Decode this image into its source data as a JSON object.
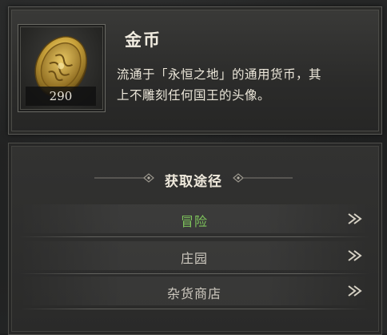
{
  "item": {
    "name": "金币",
    "quantity": "290",
    "description_line1": "流通于「永恒之地」的通用货币，其",
    "description_line2": "上不雕刻任何国王的头像。",
    "icon": "gold-coin-icon"
  },
  "acquisition": {
    "title": "获取途径",
    "options": [
      {
        "label": "冒险",
        "active": true
      },
      {
        "label": "庄园",
        "active": false
      },
      {
        "label": "杂货商店",
        "active": false
      }
    ]
  },
  "colors": {
    "active_green": "#7fc65c",
    "text_light": "#efe9dc",
    "text_muted": "#cfcac0",
    "gold": "#c9a23a"
  }
}
